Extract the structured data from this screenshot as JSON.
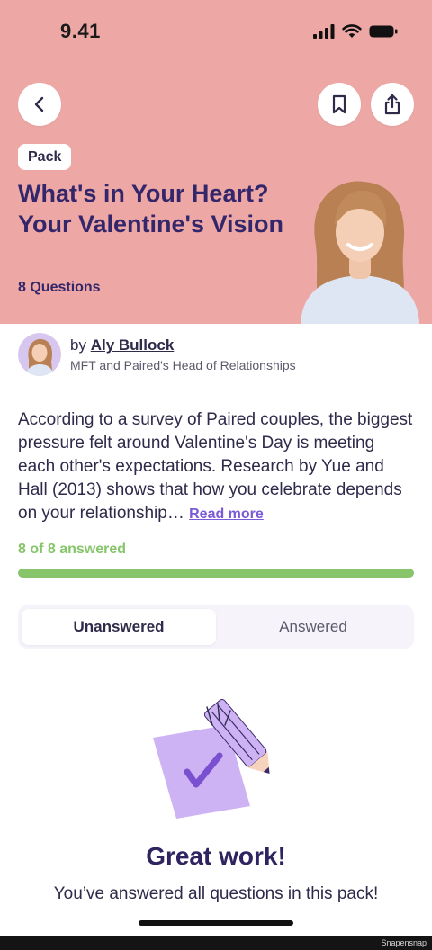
{
  "status_bar": {
    "time": "9.41"
  },
  "header": {
    "badge": "Pack",
    "title": "What's in Your Heart? Your Valentine's Vision",
    "question_count": "8 Questions"
  },
  "author": {
    "by_prefix": "by",
    "name": "Aly Bullock",
    "role": "MFT and Paired's Head of Relationships"
  },
  "description": {
    "text": "According to a survey of Paired couples, the biggest pressure felt around Valentine's Day is meeting each other's expectations. Research by Yue and Hall (2013) shows that how you celebrate depends on your relationship…",
    "read_more": "Read more"
  },
  "progress": {
    "label": "8 of 8 answered",
    "answered": 8,
    "total": 8
  },
  "tabs": [
    {
      "label": "Unanswered",
      "active": true
    },
    {
      "label": "Answered",
      "active": false
    }
  ],
  "empty_state": {
    "title": "Great work!",
    "subtitle": "You’ve answered all questions in this pack!"
  },
  "watermark": "Snapensnap",
  "colors": {
    "hero_background": "#eda8a6",
    "title": "#34266a",
    "accent_purple": "#7a5ad6",
    "progress_green": "#86c56a"
  },
  "icons": {
    "back": "chevron-left-icon",
    "bookmark": "bookmark-icon",
    "share": "share-icon"
  }
}
